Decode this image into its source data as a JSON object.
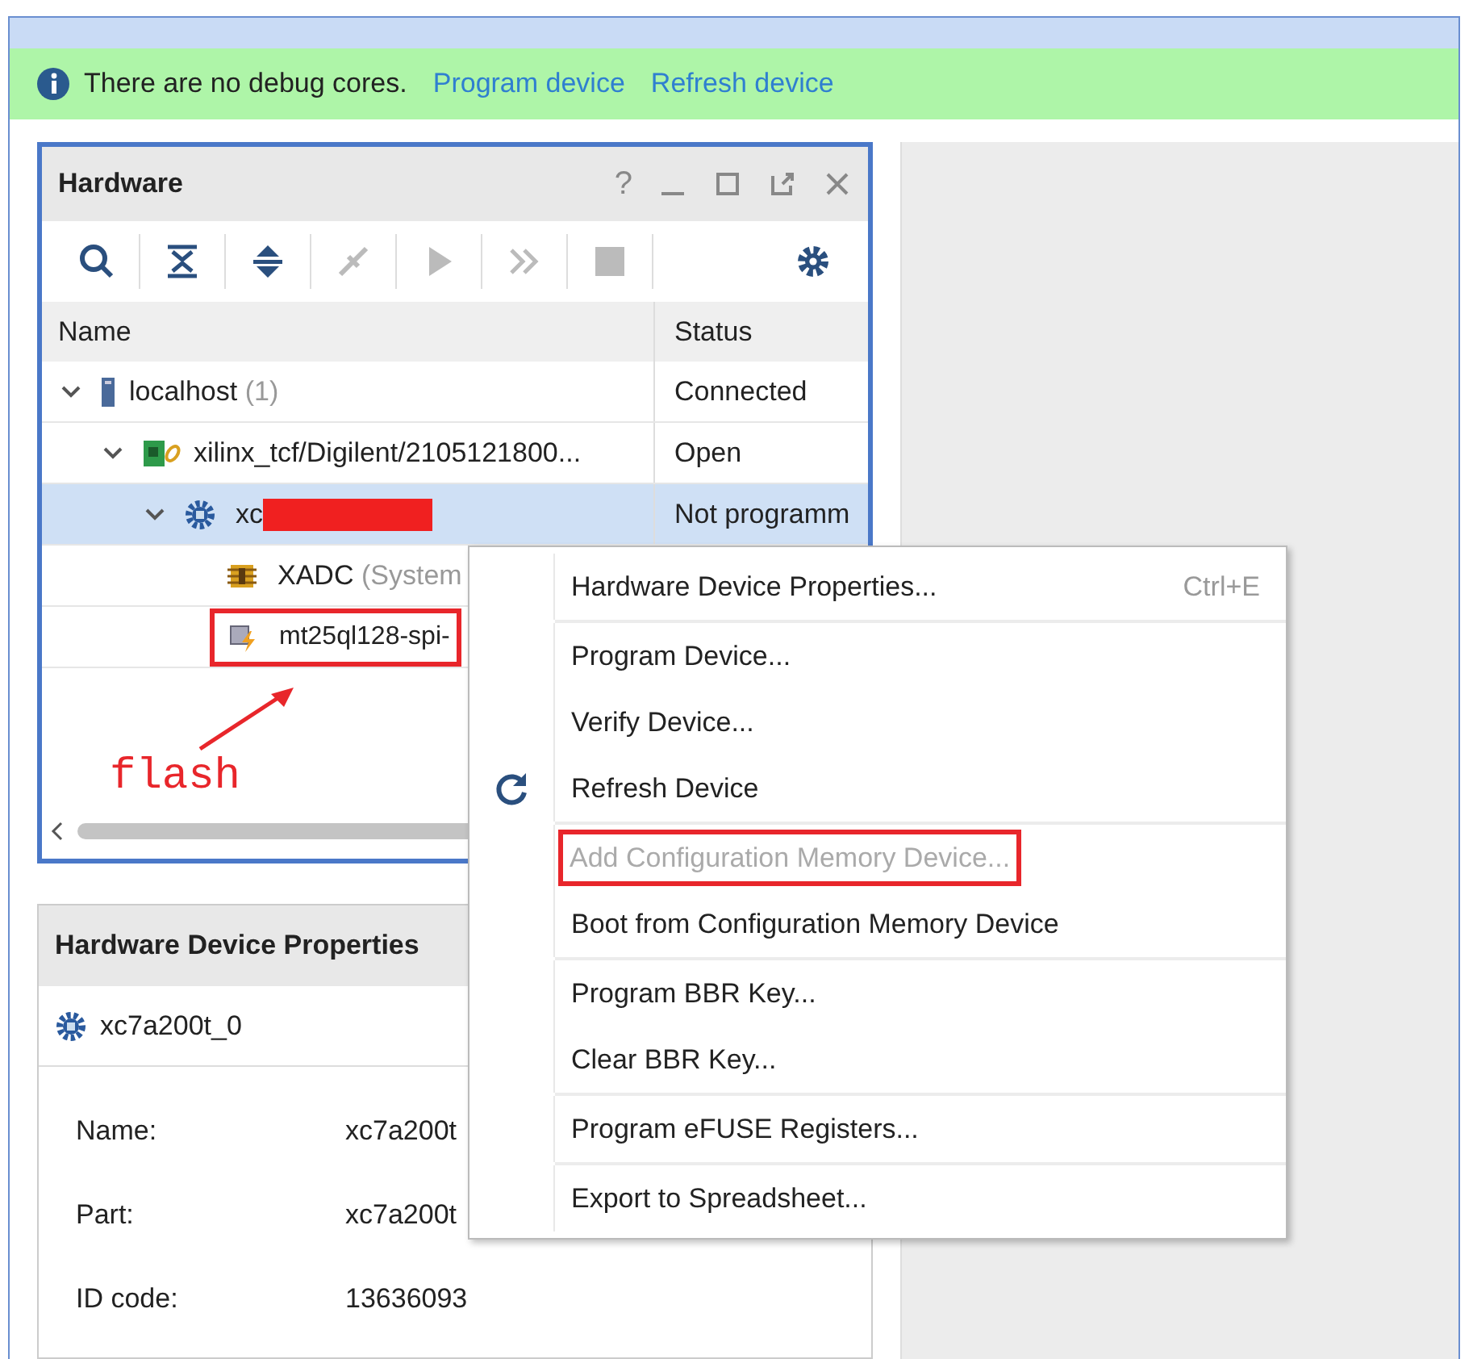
{
  "banner": {
    "message": "There are no debug cores.",
    "links": [
      "Program device",
      "Refresh device"
    ]
  },
  "hardware": {
    "title": "Hardware",
    "help": "?",
    "window_buttons": [
      {
        "kind": "minimize"
      },
      {
        "kind": "maximize"
      },
      {
        "kind": "float"
      },
      {
        "kind": "close"
      }
    ],
    "toolbar": [
      {
        "kind": "search",
        "disabled": false
      },
      {
        "kind": "collapse",
        "disabled": false
      },
      {
        "kind": "expand",
        "disabled": false
      },
      {
        "kind": "connect",
        "disabled": true
      },
      {
        "kind": "run",
        "disabled": true
      },
      {
        "kind": "step",
        "disabled": true
      },
      {
        "kind": "stop",
        "disabled": true
      },
      {
        "kind": "settings",
        "disabled": false
      }
    ],
    "columns": [
      "Name",
      "Status"
    ],
    "tree": [
      {
        "name": "localhost",
        "suffix": "(1)",
        "kind": "server",
        "status": "Connected",
        "selected": false,
        "expanded": true,
        "children": [
          {
            "name": "xilinx_tcf/Digilent/2105121800...",
            "kind": "board",
            "status": "Open",
            "selected": false,
            "expanded": true,
            "children": [
              {
                "name": "xc",
                "kind": "chip",
                "status": "Not programm",
                "selected": true,
                "expanded": true,
                "redacted": true,
                "children": [
                  {
                    "name": "XADC",
                    "suffix": "(System",
                    "kind": "xadc",
                    "selected": false
                  },
                  {
                    "name": "mt25ql128-spi-",
                    "kind": "flash",
                    "selected": false,
                    "annotated": true
                  }
                ]
              }
            ]
          }
        ]
      }
    ]
  },
  "annotation_label": "flash",
  "properties": {
    "title": "Hardware Device Properties",
    "device": "xc7a200t_0",
    "rows": [
      {
        "label": "Name:",
        "value": "xc7a200t"
      },
      {
        "label": "Part:",
        "value": "xc7a200t"
      },
      {
        "label": "ID code:",
        "value": "13636093"
      }
    ]
  },
  "context_menu": [
    [
      {
        "label": "Hardware Device Properties...",
        "shortcut": "Ctrl+E",
        "disabled": false
      }
    ],
    [
      {
        "label": "Program Device...",
        "disabled": false
      },
      {
        "label": "Verify Device...",
        "disabled": false
      },
      {
        "label": "Refresh Device",
        "kind": "refresh",
        "disabled": false
      }
    ],
    [
      {
        "label": "Add Configuration Memory Device...",
        "disabled": true,
        "annotated": true
      },
      {
        "label": "Boot from Configuration Memory Device",
        "disabled": false
      }
    ],
    [
      {
        "label": "Program BBR Key...",
        "disabled": false
      },
      {
        "label": "Clear BBR Key...",
        "disabled": false
      }
    ],
    [
      {
        "label": "Program eFUSE Registers...",
        "disabled": false
      }
    ],
    [
      {
        "label": "Export to Spreadsheet...",
        "disabled": false
      }
    ]
  ]
}
